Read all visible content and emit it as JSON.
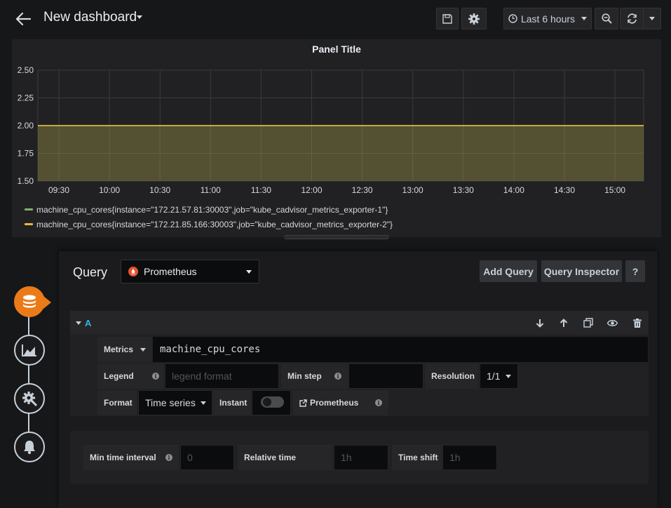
{
  "header": {
    "title": "New dashboard",
    "time_range": "Last 6 hours"
  },
  "panel": {
    "title": "Panel Title"
  },
  "chart_data": {
    "type": "area",
    "title": "Panel Title",
    "x": [
      "09:30",
      "10:00",
      "10:30",
      "11:00",
      "11:30",
      "12:00",
      "12:30",
      "13:00",
      "13:30",
      "14:00",
      "14:30",
      "15:00"
    ],
    "y_ticks": [
      "1.50",
      "1.75",
      "2.00",
      "2.25",
      "2.50"
    ],
    "ylim": [
      1.5,
      2.5
    ],
    "grid": true,
    "legend_position": "bottom-left",
    "series": [
      {
        "name": "machine_cpu_cores{instance=\"172.21.57.81:30003\",job=\"kube_cadvisor_metrics_exporter-1\"}",
        "color": "#7eb26d",
        "values": [
          2,
          2,
          2,
          2,
          2,
          2,
          2,
          2,
          2,
          2,
          2,
          2
        ]
      },
      {
        "name": "machine_cpu_cores{instance=\"172.21.85.166:30003\",job=\"kube_cadvisor_metrics_exporter-2\"}",
        "color": "#eab839",
        "values": [
          2,
          2,
          2,
          2,
          2,
          2,
          2,
          2,
          2,
          2,
          2,
          2
        ]
      }
    ]
  },
  "editor": {
    "query_label": "Query",
    "datasource": "Prometheus",
    "add_query": "Add Query",
    "query_inspector": "Query Inspector",
    "help": "?"
  },
  "query_row": {
    "ref_id": "A",
    "metrics_label": "Metrics",
    "metrics_value": "machine_cpu_cores",
    "legend_label": "Legend",
    "legend_placeholder": "legend format",
    "min_step_label": "Min step",
    "resolution_label": "Resolution",
    "resolution_value": "1/1",
    "format_label": "Format",
    "format_value": "Time series",
    "instant_label": "Instant",
    "prometheus_link": "Prometheus"
  },
  "options": {
    "min_time_interval_label": "Min time interval",
    "min_time_interval_placeholder": "0",
    "relative_time_label": "Relative time",
    "relative_time_placeholder": "1h",
    "time_shift_label": "Time shift",
    "time_shift_placeholder": "1h"
  },
  "icons": [
    "back-arrow-icon",
    "save-icon",
    "gear-icon",
    "clock-icon",
    "zoom-out-icon",
    "refresh-icon",
    "database-icon",
    "chart-icon",
    "settings-icon",
    "bell-icon",
    "arrow-down-icon",
    "arrow-up-icon",
    "copy-icon",
    "eye-icon",
    "trash-icon",
    "info-icon",
    "external-link-icon"
  ]
}
